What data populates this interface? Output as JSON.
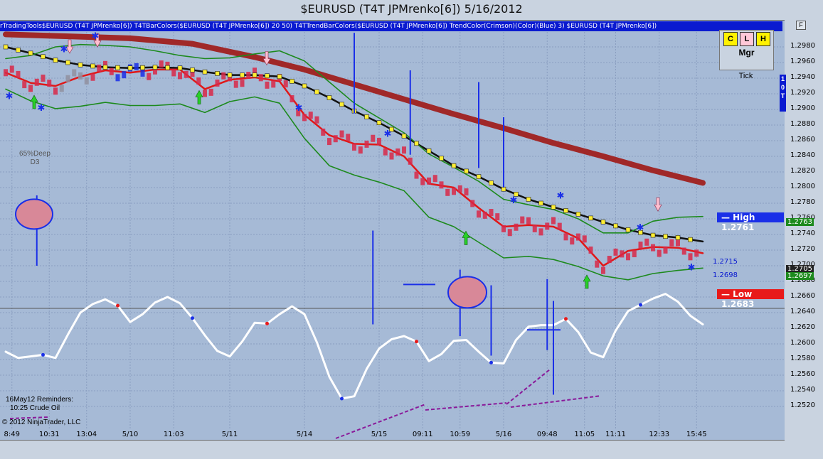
{
  "window": {
    "title": "$EURUSD (T4T JPMrenko[6])  5/16/2012",
    "indicator_strip": "rTradingTools$EURUSD (T4T JPMrenko[6]) T4TBarColors($EURUSD (T4T JPMrenko[6]) 20 50) T4TTrendBarColors($EURUSD (T4T JPMrenko[6]) TrendColor(Crimson)(Color)(Blue) 3) $EURUSD (T4T JPMrenko[6])",
    "reminder_heading": "16May12 Reminders:",
    "reminder_item": "10:25 Crude Oil",
    "copyright": "© 2012 NinjaTrader, LLC",
    "pattern_label_1": "65%Deep",
    "pattern_label_2": "D3"
  },
  "manager": {
    "keys": [
      "C",
      "L",
      "H"
    ],
    "label": "Mgr",
    "tick_label": "Tick",
    "interval_label": "1 0 T",
    "f_button": "F"
  },
  "price_labels": {
    "high": "— High 1.2761",
    "low": "— Low 1.2683",
    "last_green": "1.2763",
    "current": "1.2705",
    "last_green2": "1.2697",
    "mark_1": "1.2715",
    "mark_2": "1.2698"
  },
  "chart_data": {
    "type": "line",
    "instrument": "$EURUSD",
    "bar_type": "T4T JPMrenko[6]",
    "ylim": [
      1.251,
      1.2998
    ],
    "y_ticks": [
      "1.2980",
      "1.2960",
      "1.2940",
      "1.2920",
      "1.2900",
      "1.2880",
      "1.2860",
      "1.2840",
      "1.2820",
      "1.2800",
      "1.2780",
      "1.2760",
      "1.2740",
      "1.2720",
      "1.2700",
      "1.2680",
      "1.2660",
      "1.2640",
      "1.2620",
      "1.2600",
      "1.2580",
      "1.2560",
      "1.2540",
      "1.2520"
    ],
    "x_tick_labels": [
      "8:49",
      "10:31",
      "13:04",
      "5/10",
      "11:03",
      "5/11",
      "5/14",
      "5/15",
      "09:11",
      "10:59",
      "5/16",
      "09:48",
      "11:05",
      "11:11",
      "12:33",
      "15:45"
    ],
    "x_tick_index": [
      1,
      7,
      13,
      20,
      27,
      36,
      48,
      60,
      67,
      73,
      80,
      87,
      93,
      98,
      105,
      111
    ],
    "x_count": 113,
    "series": [
      {
        "color": "#a02828",
        "values": [
          [
            0,
            1.2996
          ],
          [
            20,
            1.2991
          ],
          [
            30,
            1.2984
          ],
          [
            40,
            1.2967
          ],
          [
            48,
            1.2951
          ],
          [
            56,
            1.2932
          ],
          [
            64,
            1.2913
          ],
          [
            72,
            1.2894
          ],
          [
            80,
            1.2876
          ],
          [
            88,
            1.2857
          ],
          [
            96,
            1.284
          ],
          [
            104,
            1.2822
          ],
          [
            112,
            1.2806
          ]
        ]
      },
      {
        "color": "#111111",
        "values": [
          [
            0,
            1.298
          ],
          [
            4,
            1.2972
          ],
          [
            8,
            1.2963
          ],
          [
            12,
            1.2957
          ],
          [
            16,
            1.2954
          ],
          [
            20,
            1.2953
          ],
          [
            24,
            1.2954
          ],
          [
            28,
            1.2953
          ],
          [
            32,
            1.2948
          ],
          [
            36,
            1.2944
          ],
          [
            40,
            1.2944
          ],
          [
            44,
            1.2942
          ],
          [
            48,
            1.293
          ],
          [
            52,
            1.2915
          ],
          [
            56,
            1.2898
          ],
          [
            60,
            1.2883
          ],
          [
            64,
            1.2866
          ],
          [
            68,
            1.2847
          ],
          [
            72,
            1.2828
          ],
          [
            76,
            1.2814
          ],
          [
            80,
            1.2798
          ],
          [
            84,
            1.2785
          ],
          [
            88,
            1.2775
          ],
          [
            92,
            1.2766
          ],
          [
            96,
            1.2756
          ],
          [
            100,
            1.2746
          ],
          [
            104,
            1.2739
          ],
          [
            108,
            1.2736
          ],
          [
            112,
            1.2731
          ]
        ]
      },
      {
        "color": "#e01818",
        "values": [
          [
            0,
            1.2947
          ],
          [
            4,
            1.2934
          ],
          [
            8,
            1.293
          ],
          [
            12,
            1.2942
          ],
          [
            16,
            1.295
          ],
          [
            20,
            1.2947
          ],
          [
            24,
            1.2951
          ],
          [
            28,
            1.2951
          ],
          [
            32,
            1.2926
          ],
          [
            36,
            1.2938
          ],
          [
            40,
            1.2941
          ],
          [
            44,
            1.2936
          ],
          [
            48,
            1.2893
          ],
          [
            52,
            1.2867
          ],
          [
            56,
            1.2856
          ],
          [
            60,
            1.2855
          ],
          [
            64,
            1.284
          ],
          [
            68,
            1.2805
          ],
          [
            72,
            1.28
          ],
          [
            76,
            1.2774
          ],
          [
            80,
            1.275
          ],
          [
            84,
            1.2752
          ],
          [
            88,
            1.275
          ],
          [
            92,
            1.2735
          ],
          [
            96,
            1.27
          ],
          [
            100,
            1.2719
          ],
          [
            104,
            1.2724
          ],
          [
            108,
            1.2723
          ],
          [
            112,
            1.2716
          ]
        ]
      },
      {
        "color": "#1d8a1d",
        "values": [
          [
            0,
            1.2965
          ],
          [
            4,
            1.2969
          ],
          [
            8,
            1.298
          ],
          [
            12,
            1.2983
          ],
          [
            16,
            1.2982
          ],
          [
            20,
            1.298
          ],
          [
            24,
            1.2975
          ],
          [
            28,
            1.2969
          ],
          [
            32,
            1.2965
          ],
          [
            36,
            1.2966
          ],
          [
            40,
            1.2971
          ],
          [
            44,
            1.2975
          ],
          [
            48,
            1.2962
          ],
          [
            52,
            1.2935
          ],
          [
            56,
            1.2908
          ],
          [
            60,
            1.2889
          ],
          [
            64,
            1.287
          ],
          [
            68,
            1.2843
          ],
          [
            72,
            1.2826
          ],
          [
            76,
            1.2808
          ],
          [
            80,
            1.2785
          ],
          [
            84,
            1.2778
          ],
          [
            88,
            1.2772
          ],
          [
            92,
            1.276
          ],
          [
            96,
            1.2742
          ],
          [
            100,
            1.2742
          ],
          [
            104,
            1.2757
          ],
          [
            108,
            1.2762
          ],
          [
            112,
            1.2763
          ]
        ]
      },
      {
        "color": "#1d8a1d",
        "values": [
          [
            0,
            1.2926
          ],
          [
            4,
            1.2911
          ],
          [
            8,
            1.2901
          ],
          [
            12,
            1.2904
          ],
          [
            16,
            1.2909
          ],
          [
            20,
            1.2905
          ],
          [
            24,
            1.2905
          ],
          [
            28,
            1.2907
          ],
          [
            32,
            1.2896
          ],
          [
            36,
            1.291
          ],
          [
            40,
            1.2916
          ],
          [
            44,
            1.2908
          ],
          [
            48,
            1.2863
          ],
          [
            52,
            1.2828
          ],
          [
            56,
            1.2816
          ],
          [
            60,
            1.2807
          ],
          [
            64,
            1.2796
          ],
          [
            68,
            1.2762
          ],
          [
            72,
            1.275
          ],
          [
            76,
            1.273
          ],
          [
            80,
            1.271
          ],
          [
            84,
            1.2712
          ],
          [
            88,
            1.2708
          ],
          [
            92,
            1.2699
          ],
          [
            96,
            1.2687
          ],
          [
            100,
            1.2682
          ],
          [
            104,
            1.269
          ],
          [
            108,
            1.2694
          ],
          [
            112,
            1.2697
          ]
        ]
      },
      {
        "color": "#ffffff",
        "values": [
          [
            0,
            1.259
          ],
          [
            2,
            1.2582
          ],
          [
            4,
            1.2584
          ],
          [
            6,
            1.2586
          ],
          [
            8,
            1.2582
          ],
          [
            10,
            1.2612
          ],
          [
            12,
            1.264
          ],
          [
            14,
            1.2651
          ],
          [
            16,
            1.2657
          ],
          [
            18,
            1.2649
          ],
          [
            20,
            1.2628
          ],
          [
            22,
            1.2638
          ],
          [
            24,
            1.2653
          ],
          [
            26,
            1.266
          ],
          [
            28,
            1.2652
          ],
          [
            30,
            1.2633
          ],
          [
            32,
            1.2611
          ],
          [
            34,
            1.2591
          ],
          [
            36,
            1.2584
          ],
          [
            38,
            1.2603
          ],
          [
            40,
            1.2627
          ],
          [
            42,
            1.2626
          ],
          [
            44,
            1.2638
          ],
          [
            46,
            1.2648
          ],
          [
            48,
            1.2638
          ],
          [
            50,
            1.2602
          ],
          [
            52,
            1.2558
          ],
          [
            54,
            1.253
          ],
          [
            56,
            1.2533
          ],
          [
            58,
            1.2568
          ],
          [
            60,
            1.2594
          ],
          [
            62,
            1.2606
          ],
          [
            64,
            1.261
          ],
          [
            66,
            1.2603
          ],
          [
            68,
            1.2578
          ],
          [
            70,
            1.2587
          ],
          [
            72,
            1.2604
          ],
          [
            74,
            1.2605
          ],
          [
            76,
            1.259
          ],
          [
            78,
            1.2576
          ],
          [
            80,
            1.2575
          ],
          [
            82,
            1.2605
          ],
          [
            84,
            1.2622
          ],
          [
            86,
            1.2624
          ],
          [
            88,
            1.2624
          ],
          [
            90,
            1.2632
          ],
          [
            92,
            1.2615
          ],
          [
            94,
            1.2589
          ],
          [
            96,
            1.2583
          ],
          [
            98,
            1.2617
          ],
          [
            100,
            1.2642
          ],
          [
            102,
            1.265
          ],
          [
            104,
            1.2658
          ],
          [
            106,
            1.2664
          ],
          [
            108,
            1.2654
          ],
          [
            110,
            1.2636
          ],
          [
            112,
            1.2625
          ]
        ]
      }
    ]
  }
}
